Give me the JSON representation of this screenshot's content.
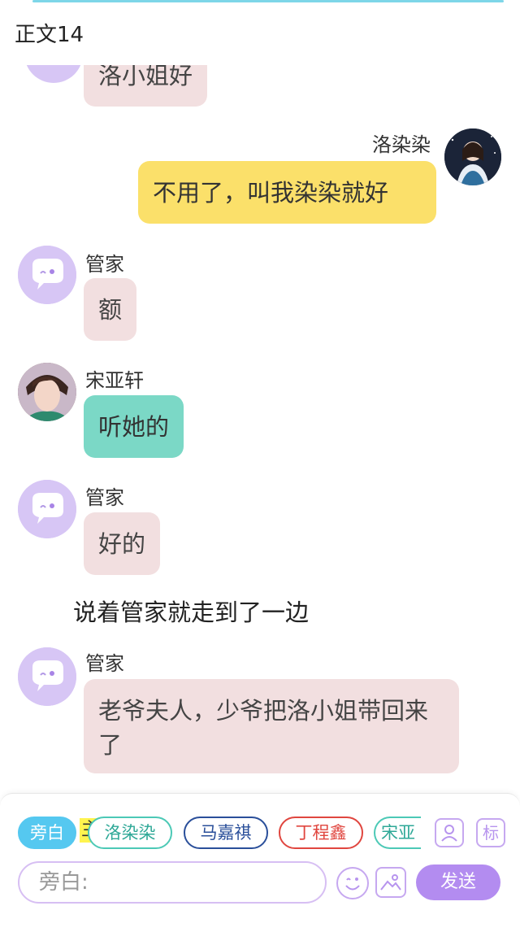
{
  "header": {
    "title": "正文14"
  },
  "messages": [
    {
      "side": "left",
      "speaker": "",
      "text": "洛小姐好"
    },
    {
      "side": "right",
      "speaker": "洛染染",
      "text": "不用了，叫我染染就好"
    },
    {
      "side": "left",
      "speaker": "管家",
      "text": "额"
    },
    {
      "side": "left",
      "speaker": "宋亚轩",
      "text": "听她的"
    },
    {
      "side": "left",
      "speaker": "管家",
      "text": "好的"
    },
    {
      "side": "narration",
      "speaker": "",
      "text": "说着管家就走到了一边"
    },
    {
      "side": "left",
      "speaker": "管家",
      "text": "老爷夫人，少爷把洛小姐带回来了"
    }
  ],
  "composer": {
    "chips": [
      "旁白",
      "洛染染",
      "马嘉祺",
      "丁程鑫",
      "宋亚"
    ],
    "main_marker": "主",
    "tag_label": "标",
    "input_placeholder": "旁白:",
    "send_label": "发送"
  },
  "colors": {
    "accent": "#b38cf0",
    "chip_active": "#55c8f0",
    "chip_luo": "#4cc9b6",
    "chip_ma": "#2a4f9a",
    "chip_ding": "#e0463f",
    "chip_song": "#4cc9b6",
    "bubble_pink": "#f2dfe0",
    "bubble_yellow": "#fbe06a",
    "bubble_teal": "#7bd8c6"
  }
}
